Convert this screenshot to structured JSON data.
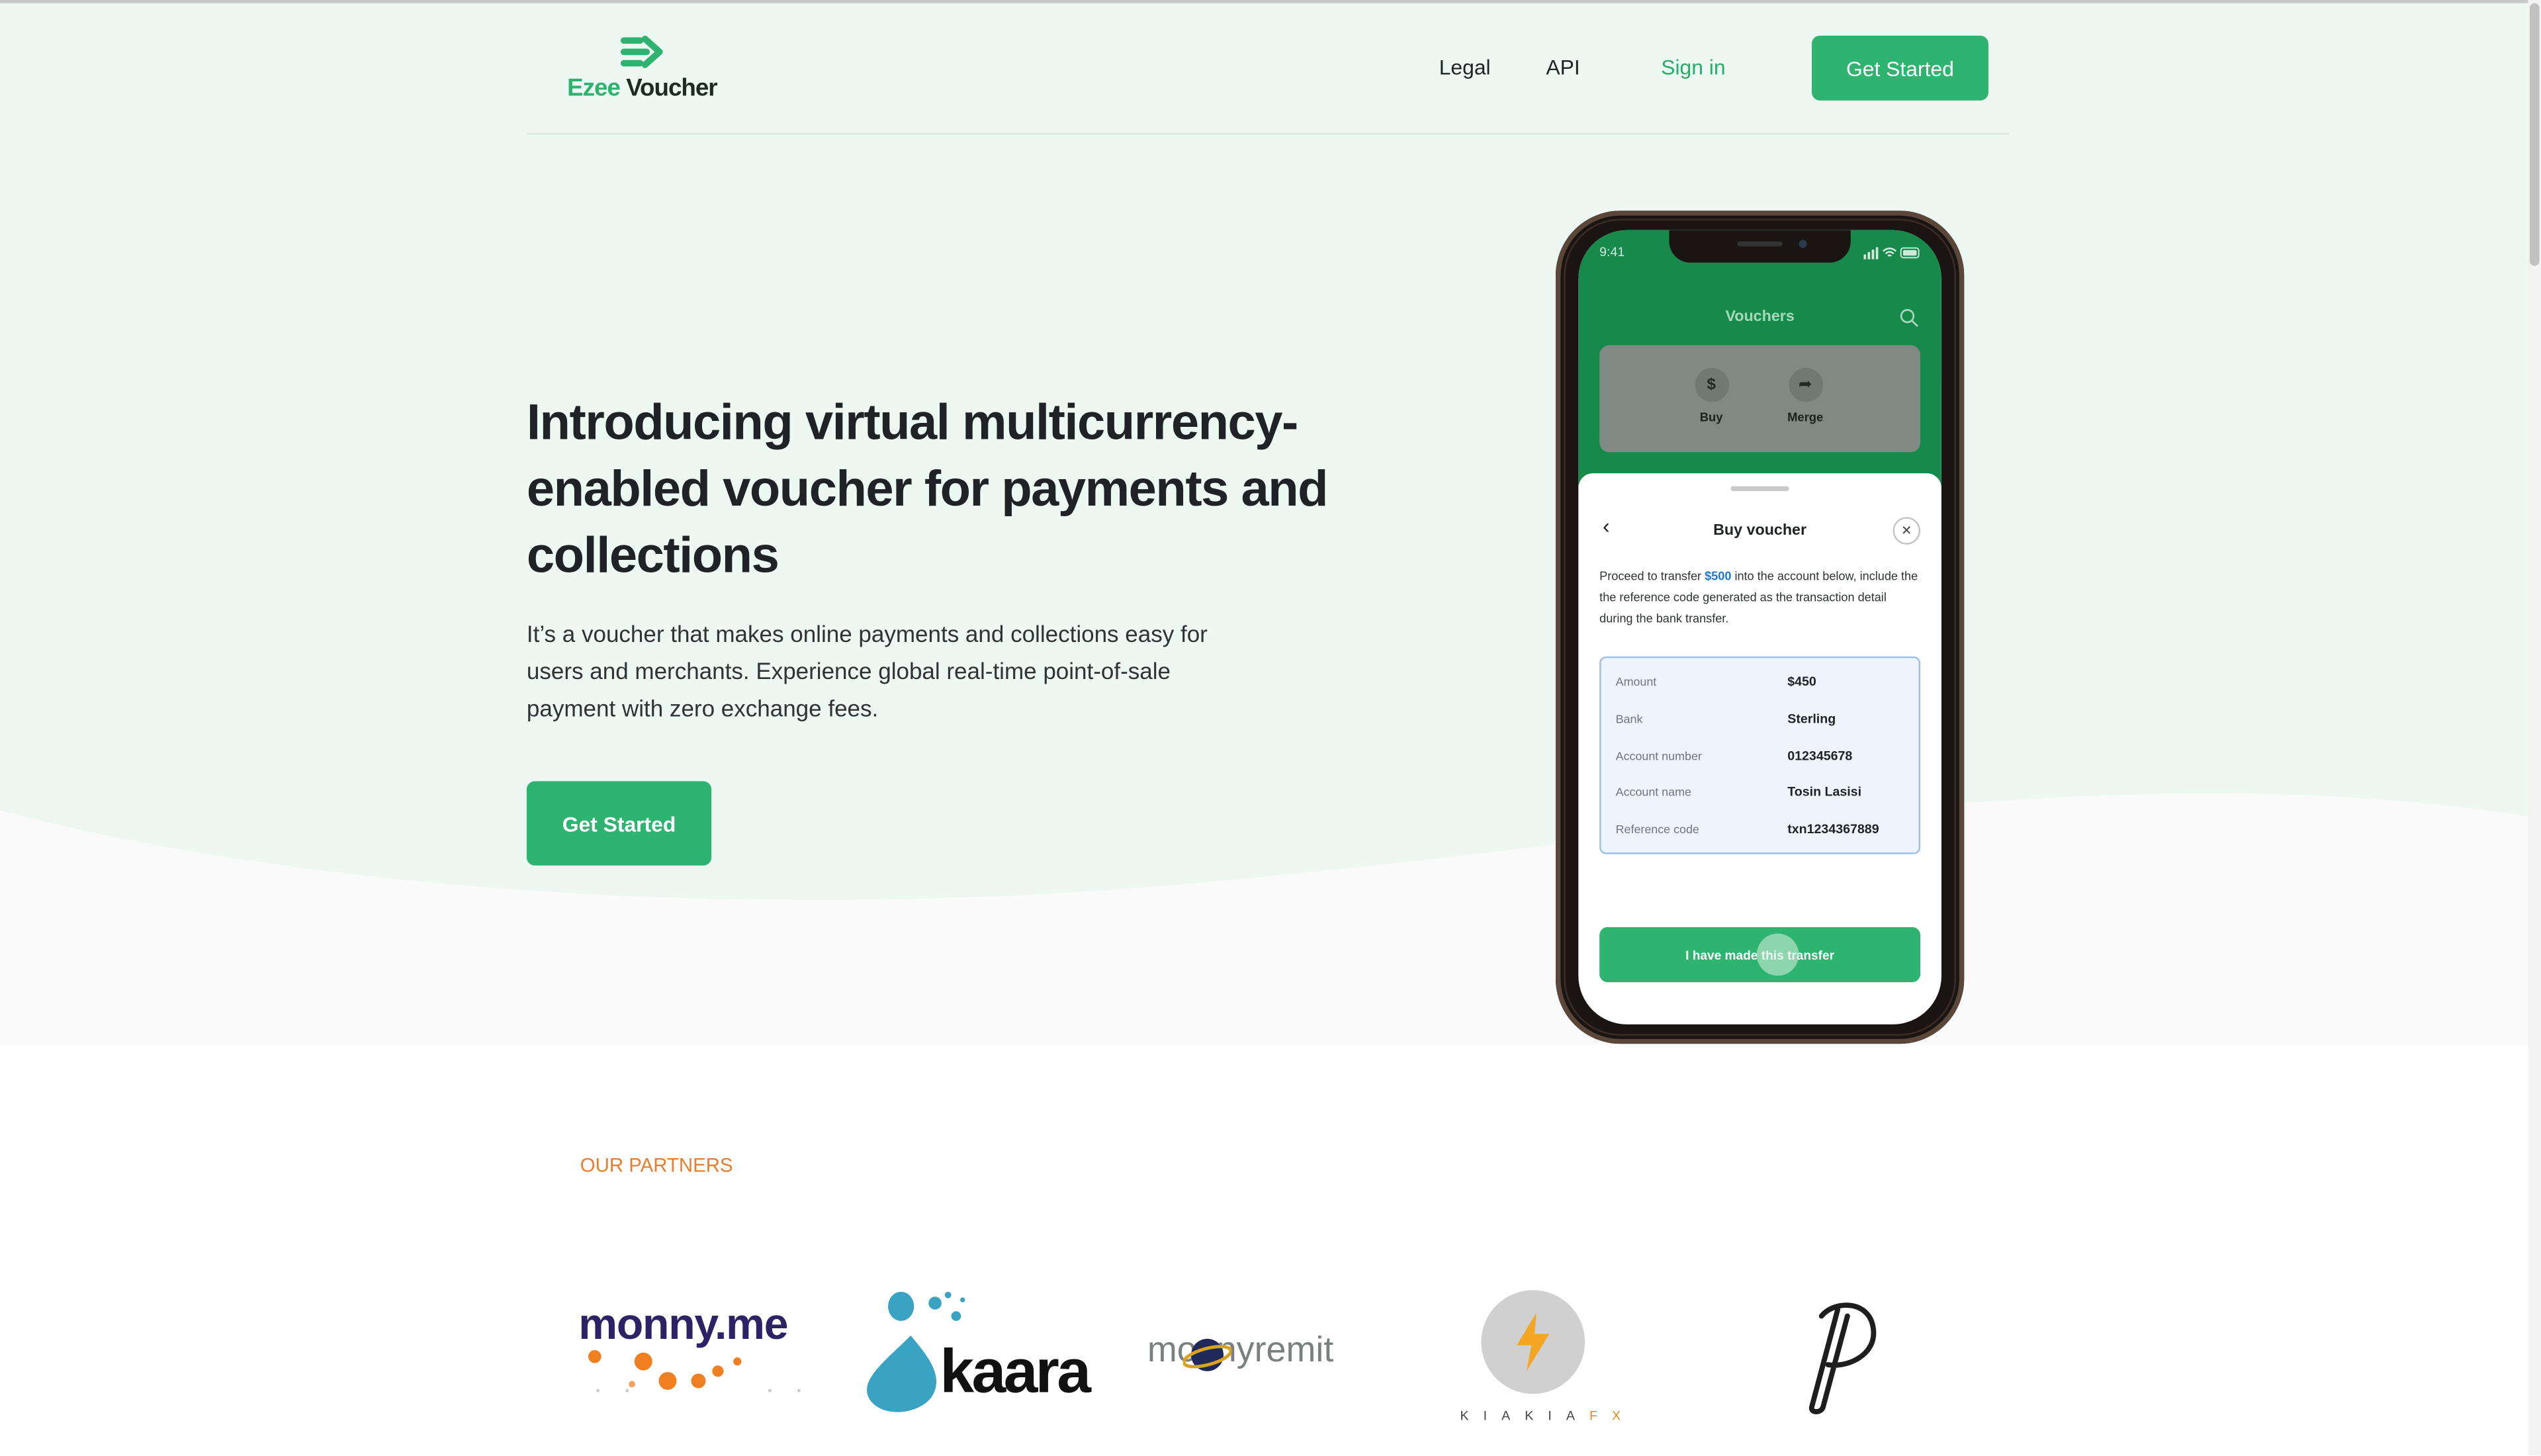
{
  "brand": {
    "name_part1": "Ezee",
    "name_part2": "Voucher",
    "green": "#2eb470",
    "dark": "#1f2326"
  },
  "nav": {
    "legal": "Legal",
    "api": "API",
    "sign_in": "Sign in",
    "cta": "Get Started"
  },
  "hero": {
    "title": "Introducing virtual multicurrency-enabled voucher for payments and collections",
    "description": "It’s a voucher that makes online payments and collections easy for users and merchants. Experience global real-time point-of-sale payment with zero exchange fees.",
    "cta": "Get Started"
  },
  "phone": {
    "time": "9:41",
    "screen_title": "Vouchers",
    "actions": [
      {
        "icon": "dollar-icon",
        "glyph": "$",
        "label": "Buy"
      },
      {
        "icon": "share-arrow-icon",
        "glyph": "➦",
        "label": "Merge"
      }
    ],
    "sheet": {
      "back_glyph": "‹",
      "title": "Buy voucher",
      "close_glyph": "✕",
      "text_before": "Proceed to transfer ",
      "amount_highlight": "$500",
      "text_after": " into the account below, include the the reference code generated as the transaction detail during the bank transfer.",
      "details": [
        {
          "label": "Amount",
          "value": "$450"
        },
        {
          "label": "Bank",
          "value": "Sterling"
        },
        {
          "label": "Account number",
          "value": "012345678"
        },
        {
          "label": "Account name",
          "value": "Tosin Lasisi"
        },
        {
          "label": "Reference code",
          "value": "txn1234367889"
        }
      ],
      "button": "I have made this transfer"
    }
  },
  "partners": {
    "label": "OUR PARTNERS",
    "logos": [
      {
        "name": "monny-logo",
        "text": "monny.me"
      },
      {
        "name": "kaara-logo",
        "text": "kaara"
      },
      {
        "name": "monnyremit-logo",
        "text": "monnyremit"
      },
      {
        "name": "kiakiafx-logo",
        "text_main": "KIAKIA",
        "text_accent": "FX"
      },
      {
        "name": "p-logo",
        "text": ""
      }
    ]
  }
}
